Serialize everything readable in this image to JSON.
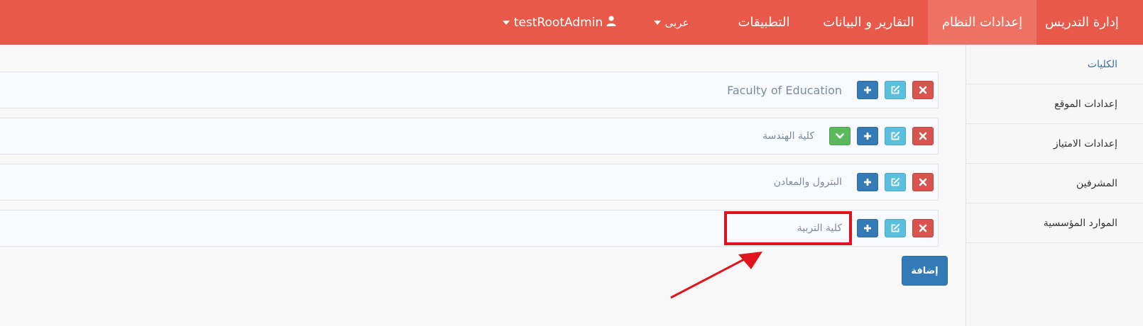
{
  "navbar": {
    "items": [
      {
        "label": "إدارة التدريس"
      },
      {
        "label": "إعدادات النظام"
      },
      {
        "label": "التقارير و البيانات"
      },
      {
        "label": "التطبيقات"
      }
    ],
    "language_label": "عربى",
    "user_label": "testRootAdmin",
    "colors": {
      "bar": "#e9594a",
      "active": "#ee7264"
    }
  },
  "sidebar": {
    "items": [
      {
        "label": "الكليات"
      },
      {
        "label": "إعدادات الموقع"
      },
      {
        "label": "إعدادات الامتياز"
      },
      {
        "label": "المشرفين"
      },
      {
        "label": "الموارد المؤسسية"
      }
    ]
  },
  "faculties": [
    {
      "name": "Faculty of Education"
    },
    {
      "name": "كلية الهندسة"
    },
    {
      "name": "البترول والمعادن"
    },
    {
      "name": "كلية التربية"
    }
  ],
  "actions": {
    "add_label": "إضافة"
  },
  "icons": {
    "delete": "times-icon",
    "edit": "edit-icon",
    "add": "plus-icon",
    "expand": "chevron-down-icon",
    "user": "user-icon"
  }
}
